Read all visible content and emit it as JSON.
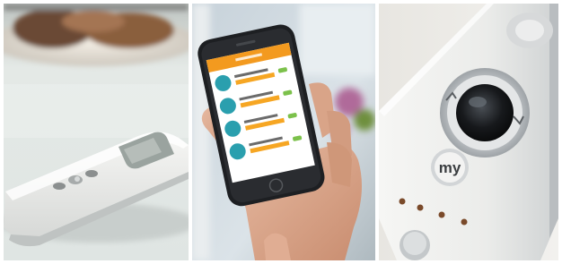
{
  "panels": [
    {
      "subject": "handheld-remote-on-table"
    },
    {
      "subject": "smartphone-app-in-hand"
    },
    {
      "subject": "remote-closeup-my-button"
    }
  ],
  "remote_button": {
    "label": "my"
  },
  "colors": {
    "app_header": "#f39a1f",
    "app_bar": "#f6a623",
    "teal": "#2a9fae",
    "remote_white": "#eeeeec",
    "remote_grey": "#c9cdd0",
    "led_brown": "#7a4a2a"
  }
}
